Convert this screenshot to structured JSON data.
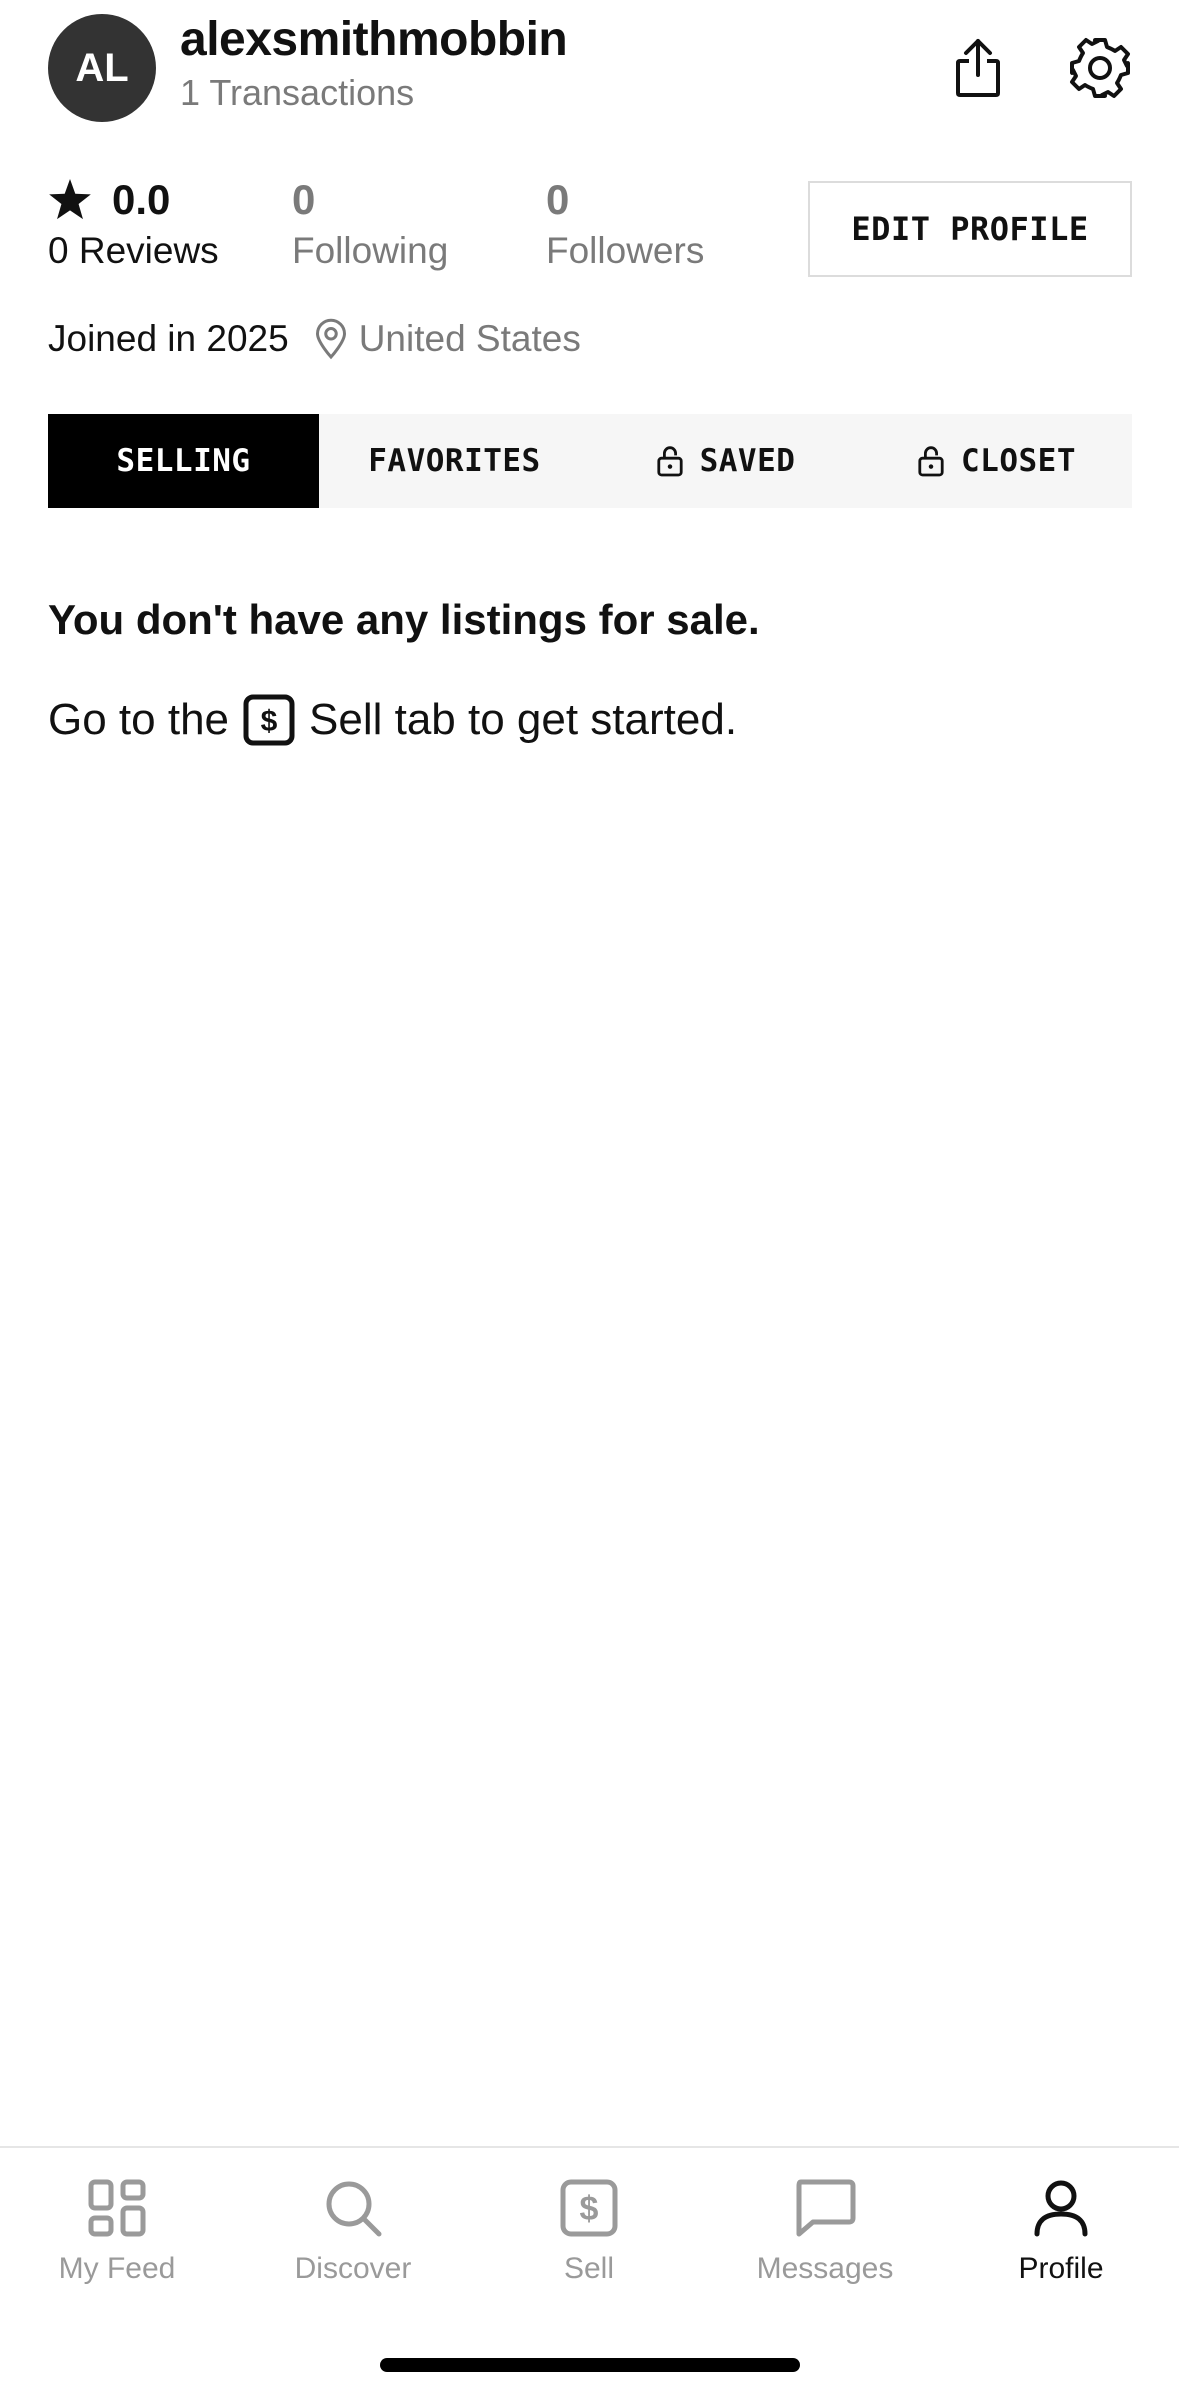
{
  "profile": {
    "avatar_initials": "AL",
    "username": "alexsmithmobbin",
    "transactions": "1 Transactions",
    "rating": "0.0",
    "reviews_label": "0 Reviews",
    "following_count": "0",
    "following_label": "Following",
    "followers_count": "0",
    "followers_label": "Followers",
    "edit_label": "EDIT PROFILE",
    "joined": "Joined in 2025",
    "location": "United States"
  },
  "header_icons": {
    "share": "share-icon",
    "settings": "gear-icon"
  },
  "tabs": [
    {
      "label": "SELLING",
      "active": true,
      "locked": false
    },
    {
      "label": "FAVORITES",
      "active": false,
      "locked": false
    },
    {
      "label": "SAVED",
      "active": false,
      "locked": true
    },
    {
      "label": "CLOSET",
      "active": false,
      "locked": true
    }
  ],
  "empty_state": {
    "title": "You don't have any listings for sale.",
    "prefix": "Go to the",
    "suffix": "Sell tab to get started."
  },
  "bottom_nav": [
    {
      "label": "My Feed",
      "icon": "grid-icon",
      "active": false
    },
    {
      "label": "Discover",
      "icon": "search-icon",
      "active": false
    },
    {
      "label": "Sell",
      "icon": "dollar-tag-icon",
      "active": false
    },
    {
      "label": "Messages",
      "icon": "chat-bubble-icon",
      "active": false
    },
    {
      "label": "Profile",
      "icon": "person-icon",
      "active": true
    }
  ],
  "colors": {
    "primary": "#000000",
    "muted": "#7a7a7a",
    "tab_bg": "#f6f6f6",
    "avatar_bg": "#333333"
  }
}
